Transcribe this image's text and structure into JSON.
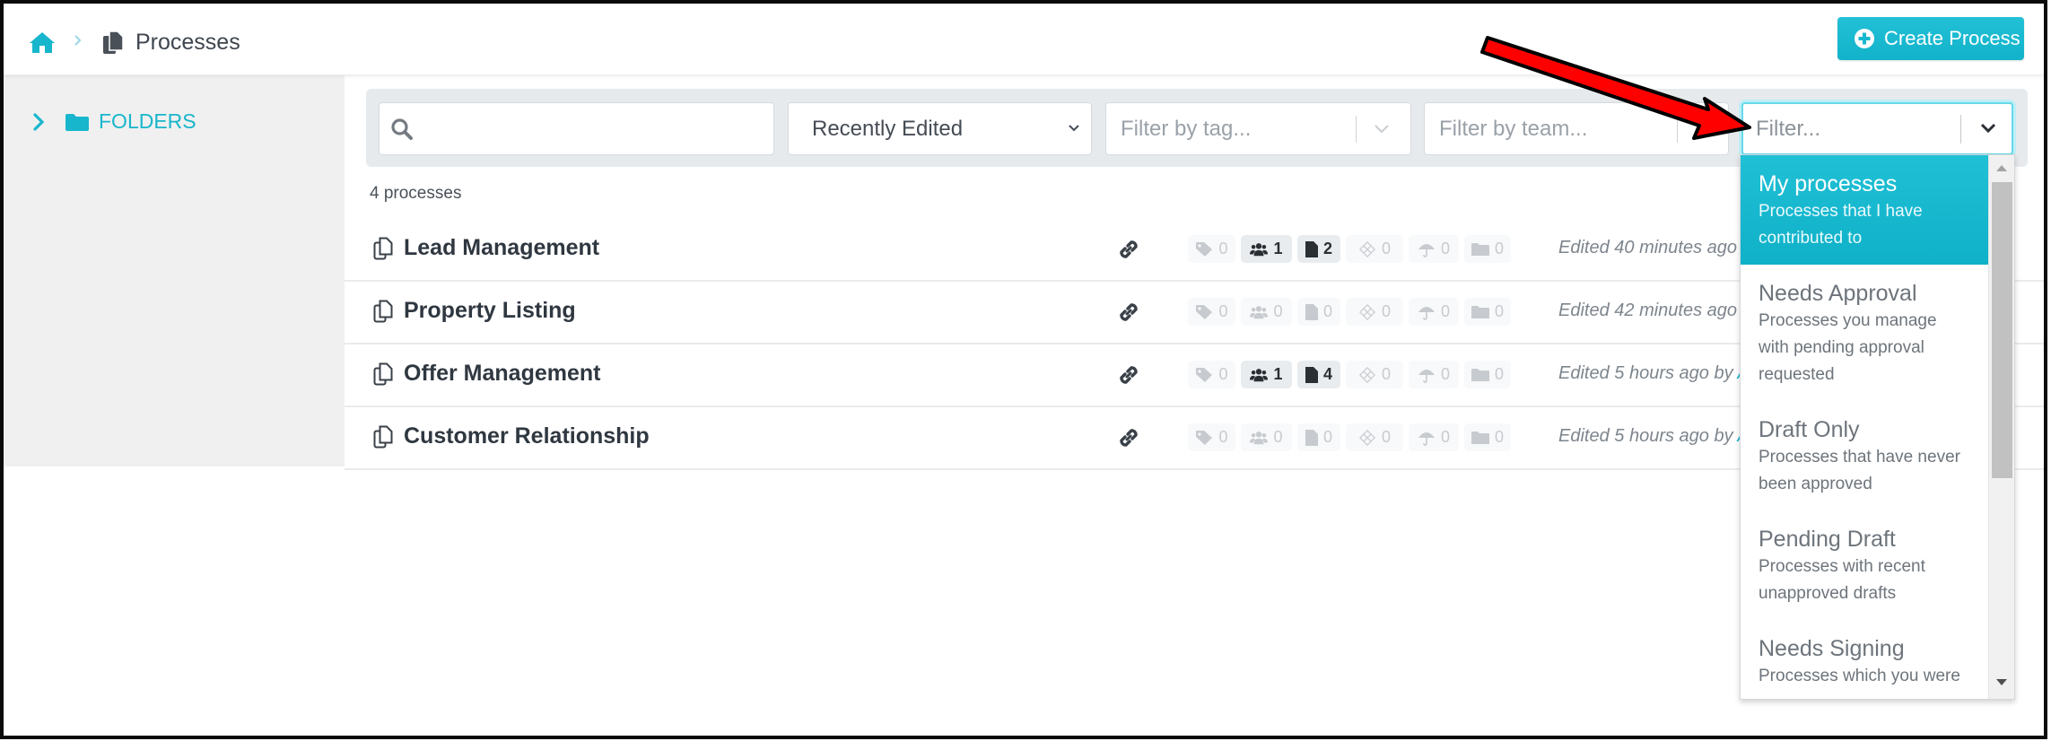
{
  "header": {
    "breadcrumb_home_icon": "home-icon",
    "breadcrumb_separator_icon": "chevron-right-icon",
    "page_icon": "copy-icon",
    "title": "Processes",
    "create_button": {
      "icon": "plus-circle-icon",
      "label": "Create Process"
    }
  },
  "sidebar": {
    "folders": {
      "expand_icon": "chevron-right-icon",
      "icon": "folder-icon",
      "label": "FOLDERS"
    }
  },
  "filters": {
    "search": {
      "icon": "search-icon",
      "value": "",
      "placeholder": ""
    },
    "sort": {
      "selected": "Recently Edited"
    },
    "tag": {
      "placeholder": "Filter by tag..."
    },
    "team": {
      "placeholder": "Filter by team..."
    },
    "filter": {
      "placeholder": "Filter..."
    }
  },
  "count_label": "4 processes",
  "processes": [
    {
      "name": "Lead Management",
      "badges": {
        "tags": "0",
        "teams": "1",
        "docs": "2",
        "diamond": "0",
        "umbrella": "0",
        "folders": "0"
      },
      "edited": "Edited 40 minutes ago",
      "author": ""
    },
    {
      "name": "Property Listing",
      "badges": {
        "tags": "0",
        "teams": "0",
        "docs": "0",
        "diamond": "0",
        "umbrella": "0",
        "folders": "0"
      },
      "edited": "Edited 42 minutes ago",
      "author": ""
    },
    {
      "name": "Offer Management",
      "badges": {
        "tags": "0",
        "teams": "1",
        "docs": "4",
        "diamond": "0",
        "umbrella": "0",
        "folders": "0"
      },
      "edited": "Edited 5 hours ago by ",
      "author": "A"
    },
    {
      "name": "Customer Relationship",
      "badges": {
        "tags": "0",
        "teams": "0",
        "docs": "0",
        "diamond": "0",
        "umbrella": "0",
        "folders": "0"
      },
      "edited": "Edited 5 hours ago by ",
      "author": "A"
    }
  ],
  "filter_menu": {
    "options": [
      {
        "title": "My processes",
        "description": "Processes that I have contributed to",
        "active": true
      },
      {
        "title": "Needs Approval",
        "description": "Processes you manage with pending approval requested",
        "active": false
      },
      {
        "title": "Draft Only",
        "description": "Processes that have never been approved",
        "active": false
      },
      {
        "title": "Pending Draft",
        "description": "Processes with recent unapproved drafts",
        "active": false
      },
      {
        "title": "Needs Signing",
        "description": "Processes which you were",
        "active": false
      }
    ]
  },
  "colors": {
    "accent": "#18b6cc",
    "annotation_arrow": "#ff0000",
    "sidebar_bg": "#f0f0f0",
    "filterbar_bg": "#e7eaed"
  }
}
